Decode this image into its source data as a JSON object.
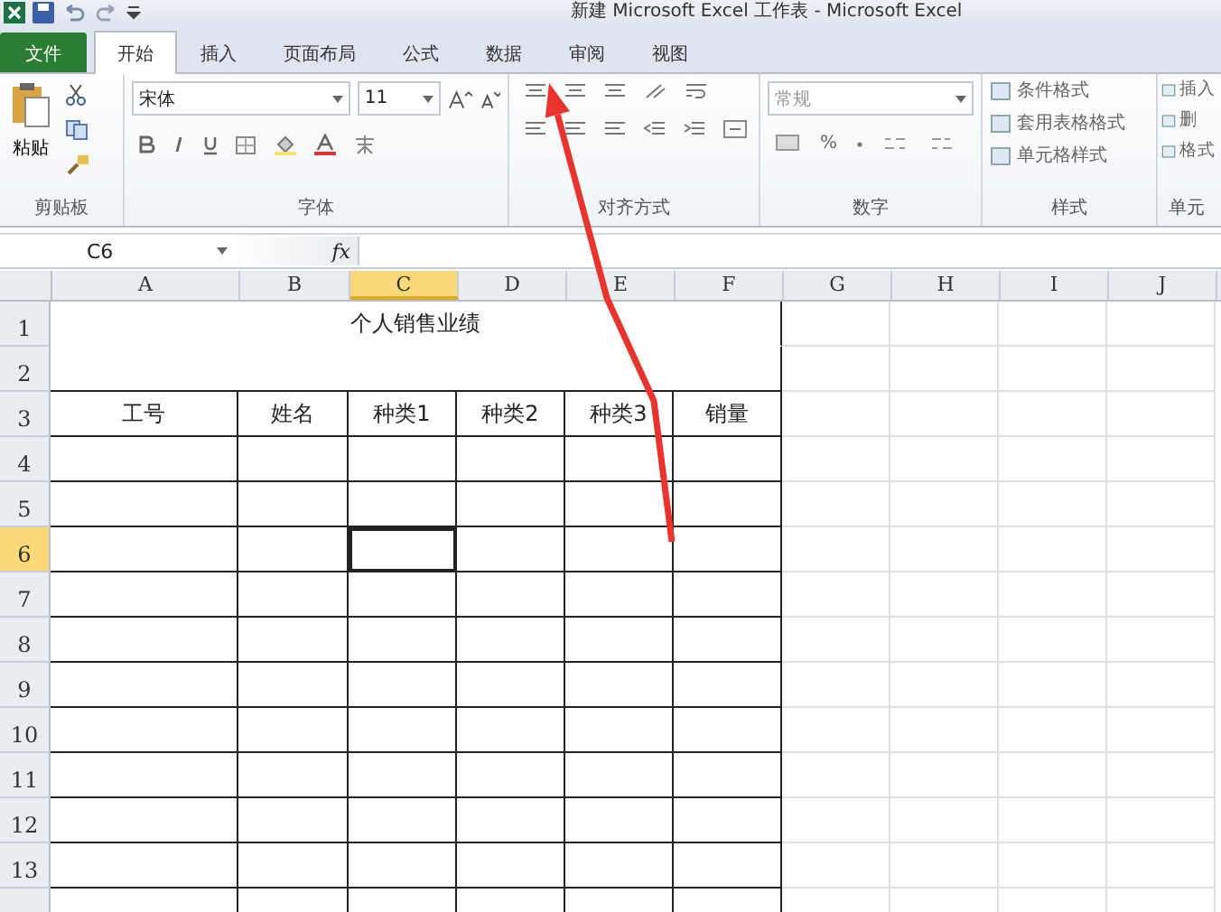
{
  "window": {
    "title": "新建 Microsoft Excel 工作表 - Microsoft Excel"
  },
  "tabs": [
    {
      "label": "文件",
      "kind": "file",
      "selected": false
    },
    {
      "label": "开始",
      "kind": "tab",
      "selected": true
    },
    {
      "label": "插入",
      "kind": "tab",
      "selected": false
    },
    {
      "label": "页面布局",
      "kind": "tab",
      "selected": false
    },
    {
      "label": "公式",
      "kind": "tab",
      "selected": false
    },
    {
      "label": "数据",
      "kind": "tab",
      "selected": false
    },
    {
      "label": "审阅",
      "kind": "tab",
      "selected": false
    },
    {
      "label": "视图",
      "kind": "tab",
      "selected": false
    }
  ],
  "ribbon": {
    "clipboard": {
      "paste": "粘贴",
      "label": "剪贴板"
    },
    "font": {
      "font_name": "宋体",
      "font_size": "11",
      "label": "字体"
    },
    "alignment": {
      "label": "对齐方式"
    },
    "number": {
      "format": "常规",
      "percent": "%",
      "label": "数字"
    },
    "styles": {
      "items": [
        "条件格式",
        "套用表格格式",
        "单元格样式"
      ],
      "label": "样式"
    },
    "cells": {
      "items": [
        "插入",
        "删",
        "格式"
      ],
      "label": "单元"
    }
  },
  "formula_bar": {
    "name_box": "C6",
    "fx": "fx"
  },
  "sheet": {
    "columns": [
      {
        "label": "A",
        "selected": false
      },
      {
        "label": "B",
        "selected": false
      },
      {
        "label": "C",
        "selected": true
      },
      {
        "label": "D",
        "selected": false
      },
      {
        "label": "E",
        "selected": false
      },
      {
        "label": "F",
        "selected": false
      },
      {
        "label": "G",
        "selected": false
      },
      {
        "label": "H",
        "selected": false
      },
      {
        "label": "I",
        "selected": false
      },
      {
        "label": "J",
        "selected": false
      }
    ],
    "rows": [
      {
        "label": "1",
        "selected": false
      },
      {
        "label": "2",
        "selected": false
      },
      {
        "label": "3",
        "selected": false
      },
      {
        "label": "4",
        "selected": false
      },
      {
        "label": "5",
        "selected": false
      },
      {
        "label": "6",
        "selected": true
      },
      {
        "label": "7",
        "selected": false
      },
      {
        "label": "8",
        "selected": false
      },
      {
        "label": "9",
        "selected": false
      },
      {
        "label": "10",
        "selected": false
      },
      {
        "label": "11",
        "selected": false
      },
      {
        "label": "12",
        "selected": false
      },
      {
        "label": "13",
        "selected": false
      }
    ],
    "title": "个人销售业绩",
    "headers": [
      "工号",
      "姓名",
      "种类1",
      "种类2",
      "种类3",
      "销量"
    ]
  }
}
